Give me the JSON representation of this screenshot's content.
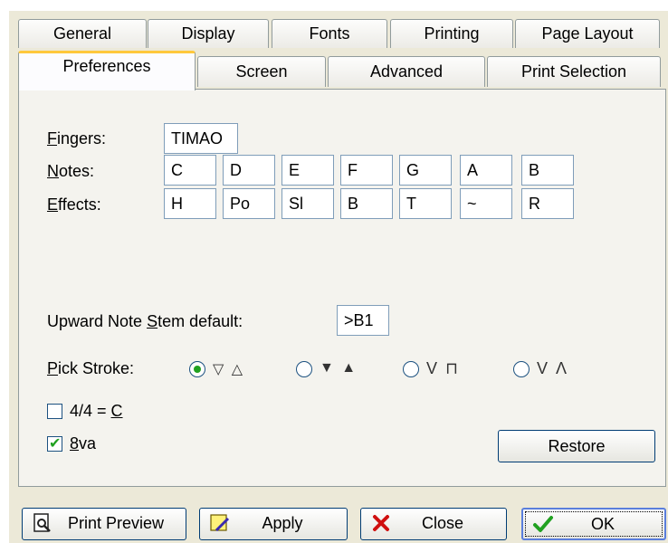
{
  "tabs_back": [
    "General",
    "Display",
    "Fonts",
    "Printing",
    "Page Layout"
  ],
  "tabs_front": [
    "Preferences",
    "Screen",
    "Advanced",
    "Print Selection"
  ],
  "active_tab": "Preferences",
  "fingers": {
    "label_underlined": "F",
    "label_rest": "ingers:",
    "value": "TIMAO"
  },
  "notes": {
    "label_underlined": "N",
    "label_rest": "otes:",
    "values": [
      "C",
      "D",
      "E",
      "F",
      "G",
      "A",
      "B"
    ]
  },
  "effects": {
    "label_underlined": "E",
    "label_rest": "ffects:",
    "values": [
      "H",
      "Po",
      "Sl",
      "B",
      "T",
      "~",
      "R"
    ]
  },
  "stem": {
    "label_pre": "Upward Note ",
    "label_underlined": "S",
    "label_rest": "tem default:",
    "value": ">B1"
  },
  "pick_stroke": {
    "label_underlined": "P",
    "label_rest": "ick Stroke:",
    "options": [
      "▽ △",
      "▼ ▲",
      "V ⊓",
      "V Λ"
    ],
    "selected_index": 0
  },
  "common_time": {
    "label_pre": "4/4 = ",
    "label_underlined": "C",
    "checked": false
  },
  "octave": {
    "label_underlined": "8",
    "label_rest": "va",
    "checked": true
  },
  "restore_label": "Restore",
  "buttons": {
    "print_preview": "Print Preview",
    "apply": "Apply",
    "close": "Close",
    "ok": "OK"
  },
  "colors": {
    "accent_tab": "#ffc83c",
    "check_green": "#21a121",
    "close_red": "#d01010"
  }
}
